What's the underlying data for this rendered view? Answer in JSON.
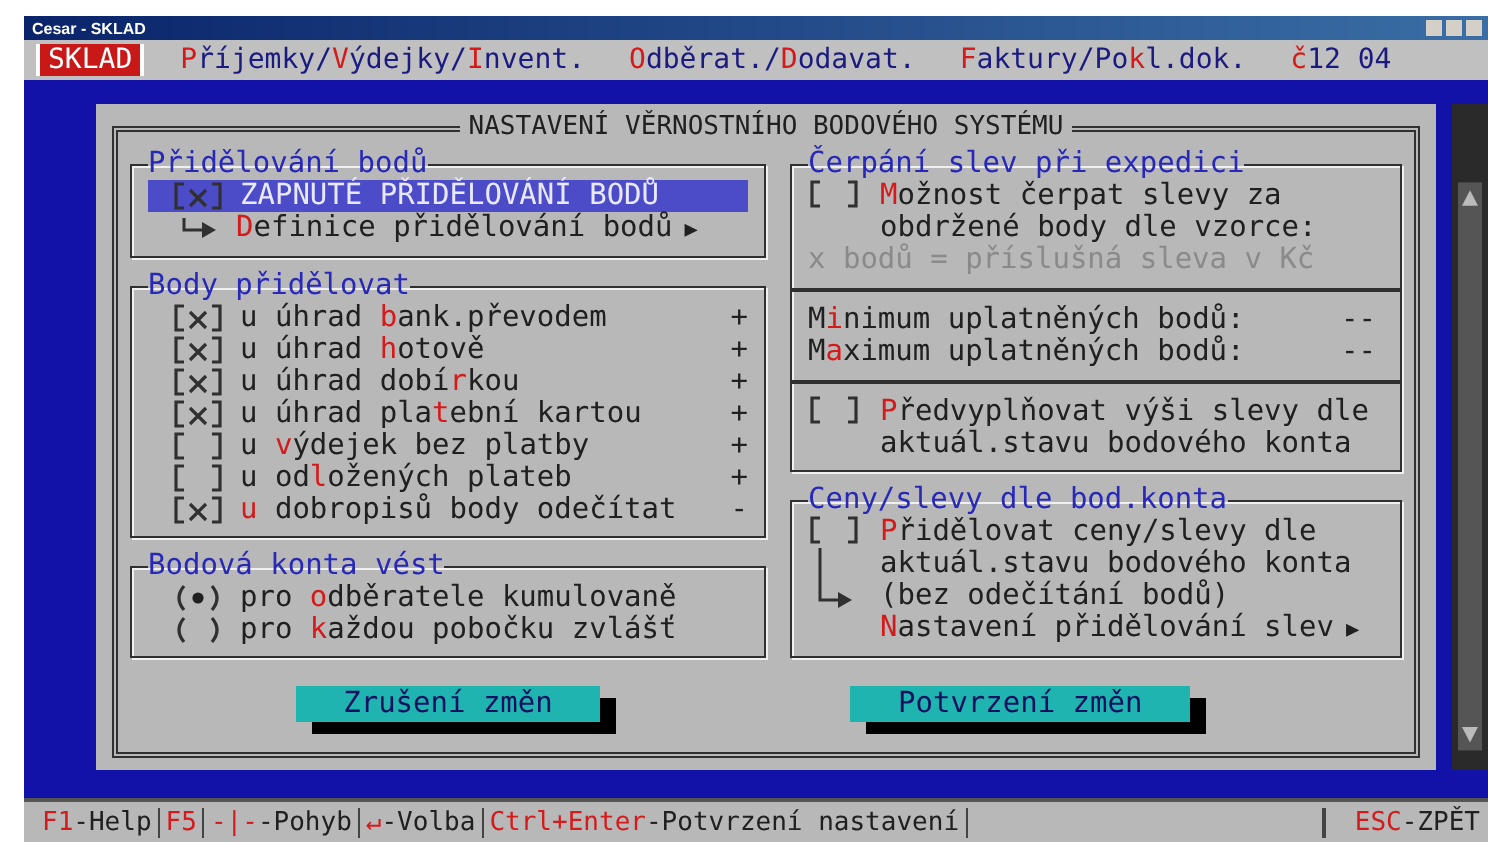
{
  "window": {
    "title": "Cesar - SKLAD"
  },
  "menu": [
    {
      "selected": true,
      "segments": [
        {
          "t": "SKLAD",
          "hot": false
        }
      ]
    },
    {
      "selected": false,
      "segments": [
        {
          "t": "P",
          "hot": true
        },
        {
          "t": "říjemky/",
          "hot": false
        },
        {
          "t": "V",
          "hot": true
        },
        {
          "t": "ýdejky/",
          "hot": false
        },
        {
          "t": "I",
          "hot": true
        },
        {
          "t": "nvent.",
          "hot": false
        }
      ]
    },
    {
      "selected": false,
      "segments": [
        {
          "t": "O",
          "hot": true
        },
        {
          "t": "dběrat./",
          "hot": false
        },
        {
          "t": "D",
          "hot": true
        },
        {
          "t": "odavat.",
          "hot": false
        }
      ]
    },
    {
      "selected": false,
      "segments": [
        {
          "t": "F",
          "hot": true
        },
        {
          "t": "aktury/Po",
          "hot": false
        },
        {
          "t": "k",
          "hot": true
        },
        {
          "t": "l.dok.",
          "hot": false
        }
      ]
    },
    {
      "selected": false,
      "segments": [
        {
          "t": "č",
          "hot": true
        },
        {
          "t": "12 04",
          "hot": false
        }
      ]
    }
  ],
  "dialog": {
    "title": "NASTAVENÍ VĚRNOSTNÍHO BODOVÉHO SYSTÉMU",
    "assignment": {
      "title": "Přidělování bodů",
      "items": [
        {
          "kind": "checkbox",
          "selected": true,
          "checked": true,
          "segments": [
            {
              "t": "ZAPNUTÉ PŘIDĚLOVÁNÍ BODŮ",
              "hot": false
            }
          ]
        },
        {
          "kind": "submenu",
          "selected": false,
          "segments": [
            {
              "t": "D",
              "hot": true
            },
            {
              "t": "efinice přidělování bodů",
              "hot": false
            }
          ],
          "marker": "▶"
        }
      ]
    },
    "award_for": {
      "title": "Body přidělovat",
      "items": [
        {
          "checked": true,
          "segments": [
            {
              "t": "u úhrad ",
              "hot": false
            },
            {
              "t": "b",
              "hot": true
            },
            {
              "t": "ank.převodem",
              "hot": false
            }
          ],
          "sign": "+"
        },
        {
          "checked": true,
          "segments": [
            {
              "t": "u úhrad ",
              "hot": false
            },
            {
              "t": "h",
              "hot": true
            },
            {
              "t": "otově",
              "hot": false
            }
          ],
          "sign": "+"
        },
        {
          "checked": true,
          "segments": [
            {
              "t": "u úhrad dobí",
              "hot": false
            },
            {
              "t": "r",
              "hot": true
            },
            {
              "t": "kou",
              "hot": false
            }
          ],
          "sign": "+"
        },
        {
          "checked": true,
          "segments": [
            {
              "t": "u úhrad pla",
              "hot": false
            },
            {
              "t": "t",
              "hot": true
            },
            {
              "t": "ební kartou",
              "hot": false
            }
          ],
          "sign": "+"
        },
        {
          "checked": false,
          "segments": [
            {
              "t": "u ",
              "hot": false
            },
            {
              "t": "v",
              "hot": true
            },
            {
              "t": "ýdejek bez platby",
              "hot": false
            }
          ],
          "sign": "+"
        },
        {
          "checked": false,
          "segments": [
            {
              "t": "u od",
              "hot": false
            },
            {
              "t": "l",
              "hot": true
            },
            {
              "t": "ožených plateb",
              "hot": false
            }
          ],
          "sign": "+"
        },
        {
          "checked": true,
          "segments": [
            {
              "t": "u",
              "hot": true
            },
            {
              "t": " dobropisů body odečítat",
              "hot": false
            }
          ],
          "sign": "-"
        }
      ]
    },
    "accounts": {
      "title": "Bodová konta vést",
      "options": [
        {
          "selected": true,
          "segments": [
            {
              "t": "pro ",
              "hot": false
            },
            {
              "t": "o",
              "hot": true
            },
            {
              "t": "dběratele kumulovaně",
              "hot": false
            }
          ]
        },
        {
          "selected": false,
          "segments": [
            {
              "t": "pro ",
              "hot": false
            },
            {
              "t": "k",
              "hot": true
            },
            {
              "t": "aždou pobočku zvlášť",
              "hot": false
            }
          ]
        }
      ]
    },
    "redeem": {
      "title": "Čerpání slev při expedici",
      "option": {
        "checked": false,
        "lines": [
          [
            {
              "t": "M",
              "hot": true
            },
            {
              "t": "ožnost čerpat slevy za",
              "hot": false
            }
          ],
          [
            {
              "t": "obdržené body dle vzorce:",
              "hot": false
            }
          ]
        ]
      },
      "formula": {
        "text": "x bodů = příslušná sleva v Kč",
        "disabled": true
      },
      "limits": [
        {
          "segments": [
            {
              "t": "M",
              "hot": false
            },
            {
              "t": "i",
              "hot": true
            },
            {
              "t": "nimum uplatněných bodů:",
              "hot": false
            }
          ],
          "value": "--"
        },
        {
          "segments": [
            {
              "t": "M",
              "hot": false
            },
            {
              "t": "a",
              "hot": true
            },
            {
              "t": "ximum uplatněných bodů:",
              "hot": false
            }
          ],
          "value": "--"
        }
      ],
      "prefill": {
        "checked": false,
        "lines": [
          [
            {
              "t": "P",
              "hot": true
            },
            {
              "t": "ředvyplňovat výši slevy dle",
              "hot": false
            }
          ],
          [
            {
              "t": "aktuál.stavu bodového konta",
              "hot": false
            }
          ]
        ]
      }
    },
    "prices": {
      "title": "Ceny/slevy dle bod.konta",
      "option": {
        "checked": false,
        "lines": [
          [
            {
              "t": "P",
              "hot": true
            },
            {
              "t": "řidělovat ceny/slevy dle",
              "hot": false
            }
          ],
          [
            {
              "t": "aktuál.stavu bodového konta",
              "hot": false
            }
          ],
          [
            {
              "t": "(bez odečítání bodů)",
              "hot": false
            }
          ]
        ]
      },
      "submenu": {
        "segments": [
          {
            "t": "N",
            "hot": true
          },
          {
            "t": "astavení přidělování slev",
            "hot": false
          }
        ],
        "marker": "▶"
      }
    },
    "buttons": [
      "Zrušení změn",
      "Potvrzení změn"
    ]
  },
  "status_bar": {
    "items": [
      {
        "segments": [
          {
            "t": "F1",
            "hot": true
          },
          {
            "t": "-Help",
            "hot": false
          }
        ]
      },
      {
        "segments": [
          {
            "t": "F5",
            "hot": true
          }
        ]
      },
      {
        "segments": [
          {
            "t": "-|-",
            "hot": true
          },
          {
            "t": "-Pohyb",
            "hot": false
          }
        ]
      },
      {
        "segments": [
          {
            "t": "↵",
            "hot": true
          },
          {
            "t": "-Volba",
            "hot": false
          }
        ]
      },
      {
        "segments": [
          {
            "t": "Ctrl+Enter",
            "hot": true
          },
          {
            "t": "-Potvrzení nastavení",
            "hot": false
          }
        ]
      }
    ],
    "right": {
      "segments": [
        {
          "t": "ESC",
          "hot": true
        },
        {
          "t": "-ZPĚT",
          "hot": false
        }
      ]
    }
  }
}
